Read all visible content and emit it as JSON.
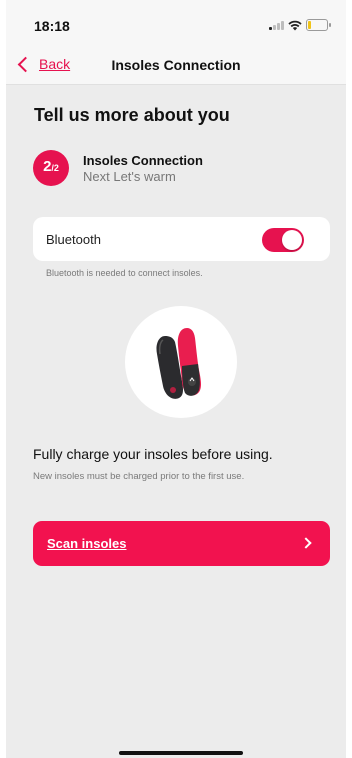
{
  "status_bar": {
    "time": "18:18"
  },
  "nav": {
    "back_label": "Back",
    "title": "Insoles Connection"
  },
  "heading": "Tell us more about you",
  "step": {
    "number": "2",
    "total": "/2",
    "title": "Insoles Connection",
    "subtitle": "Next Let's warm"
  },
  "bluetooth": {
    "label": "Bluetooth",
    "enabled": true,
    "hint": "Bluetooth is needed to connect insoles."
  },
  "charge": {
    "title": "Fully charge your insoles before using.",
    "subtitle": "New insoles must be charged prior to the first use."
  },
  "scan_button": {
    "label": "Scan insoles"
  },
  "colors": {
    "accent": "#e6124f",
    "background": "#ececec",
    "card": "#ffffff"
  },
  "icons": [
    "back-chevron-icon",
    "signal-icon",
    "wifi-icon",
    "battery-icon",
    "chevron-right-icon",
    "insoles-image"
  ]
}
